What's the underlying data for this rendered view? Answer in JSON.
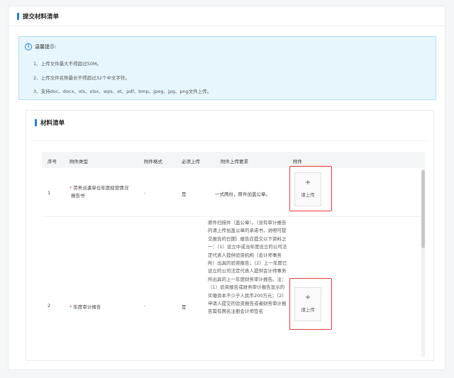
{
  "page": {
    "title": "提交材料清单"
  },
  "tips": {
    "title": "温馨提示:",
    "lines": [
      "1、上传文件最大不得超过50M。",
      "2、上传文件名称最长不得超过32个中文字符。",
      "3、支持doc、docx、xls、xlsx、wps、et、pdf、bmp、jpeg、jpg、png文件上传。"
    ]
  },
  "materials": {
    "title": "材料清单",
    "columns": [
      "序号",
      "附件类型",
      "附件格式",
      "必须上传",
      "附件上传要求",
      "附件"
    ],
    "rows": [
      {
        "no": "1",
        "type_line1": "劳务派遣单位年度经营情况",
        "type_line2": "报告书",
        "required_mark": "*",
        "format": "-",
        "required": "是",
        "requirement": "一式两份，原件加盖公章。",
        "upload_label": "请上传",
        "upload_plus": "+"
      },
      {
        "no": "2",
        "type": "年度审计报告",
        "required_mark": "*",
        "format": "-",
        "required": "是",
        "requirement": "原件扫描件（盖公章）。（没有审计报告的请上传加盖公章的承诺书，说明可提交报告的日期）报告应提交以下资料之一：（1）设立中或当年度设立的公司法定代表人提供验资机构（会计师事务所）出具的验资报告；（2）上一年度已设立的公司法定代表人提供会计师事务所出具的上一年度财务审计报告。注：（1）验资报告或财务审计报告显示的实缴资本不少于人民币200万元；（2）申请人提交的验资报告或者财务审计报告需有两名注册会计师签名",
        "upload_label": "请上传",
        "upload_plus": "+"
      }
    ]
  }
}
